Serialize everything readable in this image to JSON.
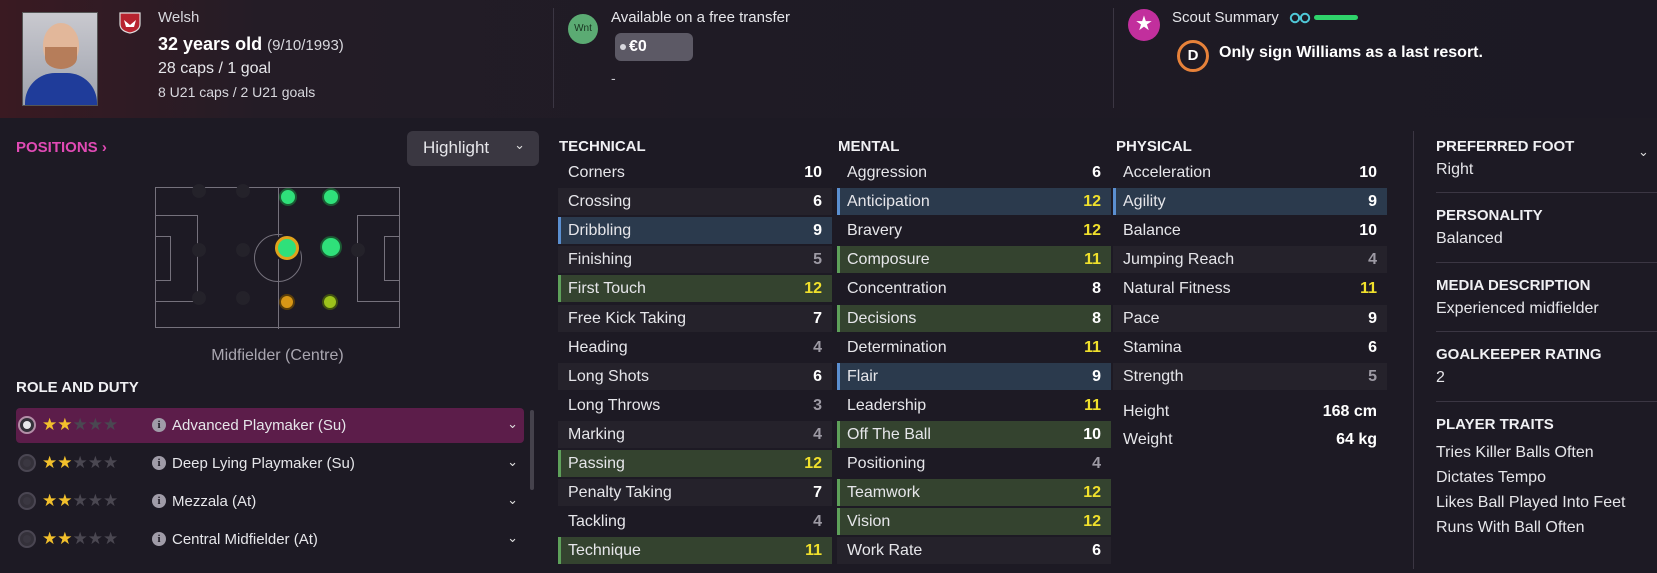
{
  "header": {
    "nationality": "Welsh",
    "age": "32 years old",
    "dob": "(9/10/1993)",
    "caps": "28 caps / 1 goal",
    "u21": "8 U21 caps / 2 U21 goals",
    "wanted_badge": "Wnt",
    "availability": "Available on a free transfer",
    "fee": "€0",
    "dash": "-",
    "scout_title": "Scout Summary",
    "scout_grade": "D",
    "scout_verdict": "Only sign Williams as a last resort."
  },
  "positions": {
    "link": "POSITIONS",
    "highlight_label": "Highlight",
    "position_label": "Midfielder (Centre)",
    "dots": [
      {
        "role": "DM",
        "rating": "natural"
      },
      {
        "role": "DM-R",
        "rating": "natural"
      },
      {
        "role": "MC",
        "rating": "natural-selected"
      },
      {
        "role": "AMC",
        "rating": "natural"
      },
      {
        "role": "MR",
        "rating": "unconvincing"
      },
      {
        "role": "AMR",
        "rating": "accomplished"
      }
    ]
  },
  "roles": {
    "title": "ROLE AND DUTY",
    "items": [
      {
        "name": "Advanced Playmaker (Su)",
        "stars": 2,
        "selected": true
      },
      {
        "name": "Deep Lying Playmaker (Su)",
        "stars": 2,
        "selected": false
      },
      {
        "name": "Mezzala (At)",
        "stars": 2,
        "selected": false
      },
      {
        "name": "Central Midfielder (At)",
        "stars": 2,
        "selected": false
      }
    ]
  },
  "attributes": {
    "technical_title": "TECHNICAL",
    "mental_title": "MENTAL",
    "physical_title": "PHYSICAL",
    "technical": [
      {
        "name": "Corners",
        "value": 10,
        "hl": ""
      },
      {
        "name": "Crossing",
        "value": 6,
        "hl": ""
      },
      {
        "name": "Dribbling",
        "value": 9,
        "hl": "blue"
      },
      {
        "name": "Finishing",
        "value": 5,
        "hl": ""
      },
      {
        "name": "First Touch",
        "value": 12,
        "hl": "green"
      },
      {
        "name": "Free Kick Taking",
        "value": 7,
        "hl": ""
      },
      {
        "name": "Heading",
        "value": 4,
        "hl": ""
      },
      {
        "name": "Long Shots",
        "value": 6,
        "hl": ""
      },
      {
        "name": "Long Throws",
        "value": 3,
        "hl": ""
      },
      {
        "name": "Marking",
        "value": 4,
        "hl": ""
      },
      {
        "name": "Passing",
        "value": 12,
        "hl": "green"
      },
      {
        "name": "Penalty Taking",
        "value": 7,
        "hl": ""
      },
      {
        "name": "Tackling",
        "value": 4,
        "hl": ""
      },
      {
        "name": "Technique",
        "value": 11,
        "hl": "green"
      }
    ],
    "mental": [
      {
        "name": "Aggression",
        "value": 6,
        "hl": ""
      },
      {
        "name": "Anticipation",
        "value": 12,
        "hl": "blue"
      },
      {
        "name": "Bravery",
        "value": 12,
        "hl": ""
      },
      {
        "name": "Composure",
        "value": 11,
        "hl": "green"
      },
      {
        "name": "Concentration",
        "value": 8,
        "hl": ""
      },
      {
        "name": "Decisions",
        "value": 8,
        "hl": "green"
      },
      {
        "name": "Determination",
        "value": 11,
        "hl": ""
      },
      {
        "name": "Flair",
        "value": 9,
        "hl": "blue"
      },
      {
        "name": "Leadership",
        "value": 11,
        "hl": ""
      },
      {
        "name": "Off The Ball",
        "value": 10,
        "hl": "green"
      },
      {
        "name": "Positioning",
        "value": 4,
        "hl": ""
      },
      {
        "name": "Teamwork",
        "value": 12,
        "hl": "green"
      },
      {
        "name": "Vision",
        "value": 12,
        "hl": "green"
      },
      {
        "name": "Work Rate",
        "value": 6,
        "hl": ""
      }
    ],
    "physical": [
      {
        "name": "Acceleration",
        "value": 10,
        "hl": ""
      },
      {
        "name": "Agility",
        "value": 9,
        "hl": "blue"
      },
      {
        "name": "Balance",
        "value": 10,
        "hl": ""
      },
      {
        "name": "Jumping Reach",
        "value": 4,
        "hl": ""
      },
      {
        "name": "Natural Fitness",
        "value": 11,
        "hl": ""
      },
      {
        "name": "Pace",
        "value": 9,
        "hl": ""
      },
      {
        "name": "Stamina",
        "value": 6,
        "hl": ""
      },
      {
        "name": "Strength",
        "value": 5,
        "hl": ""
      }
    ],
    "height_label": "Height",
    "height": "168 cm",
    "weight_label": "Weight",
    "weight": "64 kg"
  },
  "info": {
    "foot_title": "PREFERRED FOOT",
    "foot": "Right",
    "personality_title": "PERSONALITY",
    "personality": "Balanced",
    "media_title": "MEDIA DESCRIPTION",
    "media": "Experienced midfielder",
    "gk_title": "GOALKEEPER RATING",
    "gk": "2",
    "traits_title": "PLAYER TRAITS",
    "traits": [
      "Tries Killer Balls Often",
      "Dictates Tempo",
      "Likes Ball Played Into Feet",
      "Runs With Ball Often"
    ]
  },
  "colors": {
    "accent": "#e14ab5",
    "natural": "#2fe07a",
    "unconvincing": "#d89716",
    "accomplished": "#9cc21c",
    "highlight_value": "#f0e02c"
  }
}
